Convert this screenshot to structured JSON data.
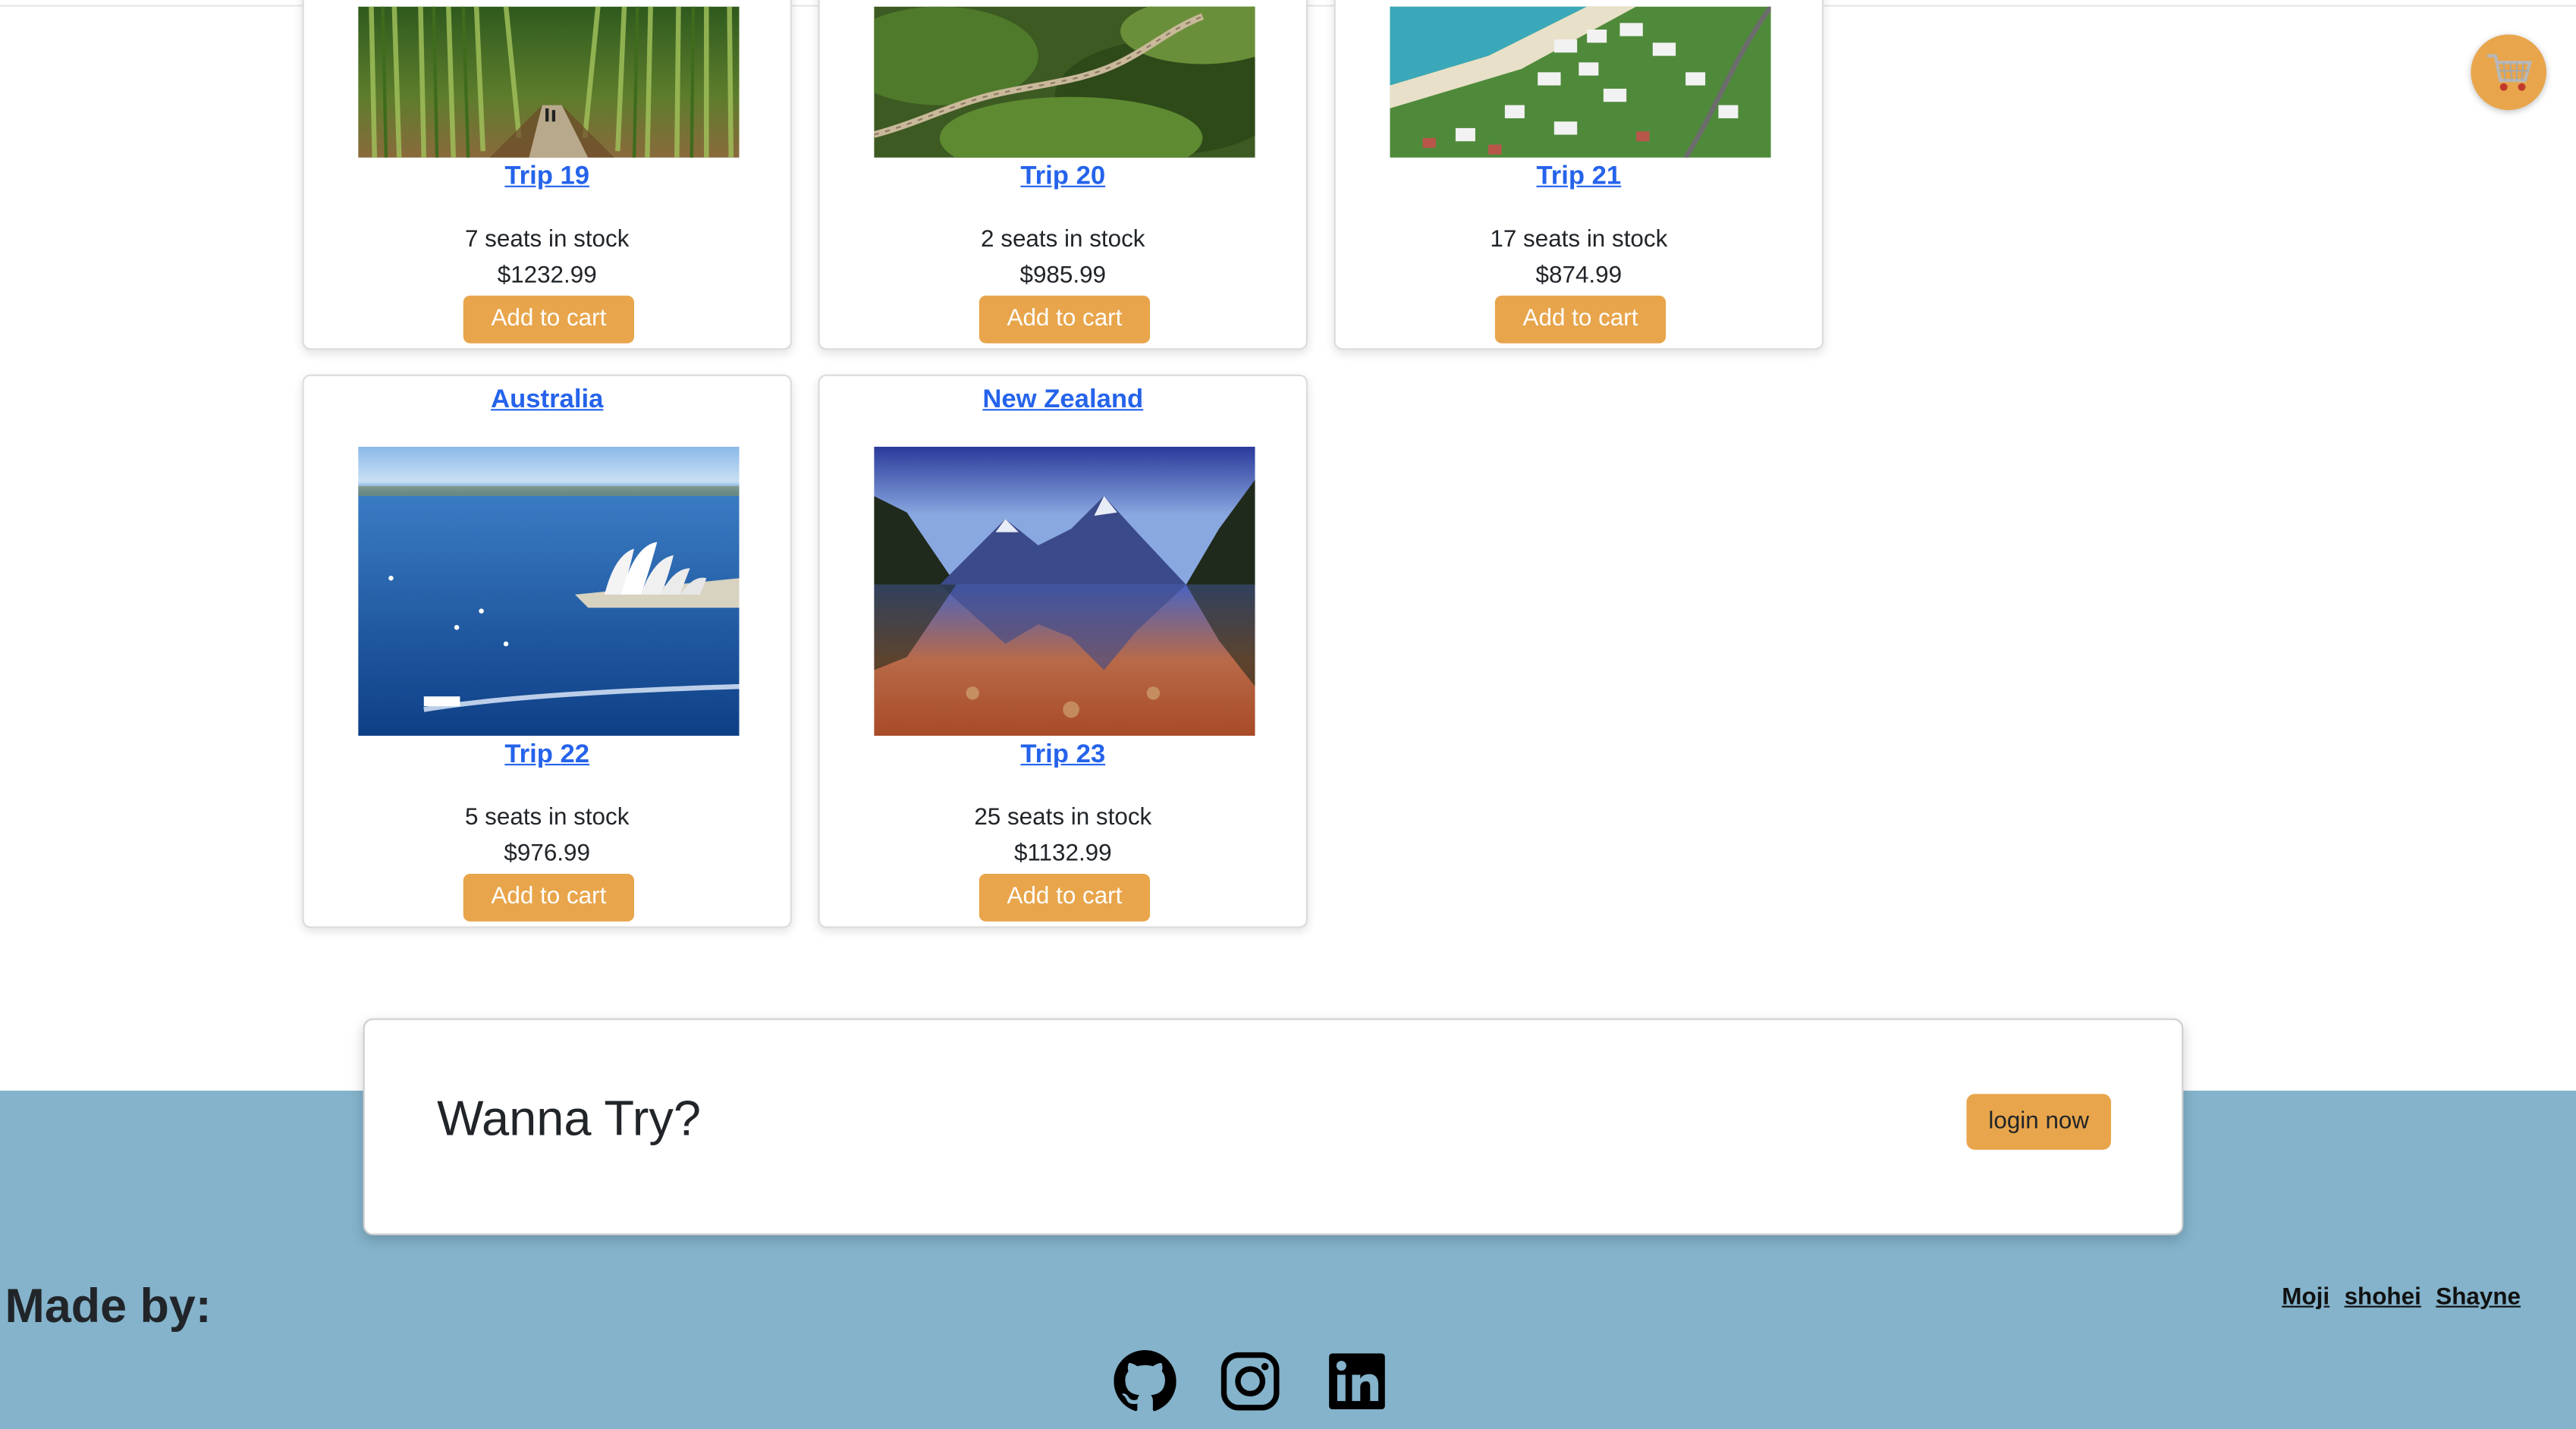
{
  "cart": {
    "icon": "shopping-cart-icon",
    "color": "#e8a54b"
  },
  "trips": [
    {
      "destination": "",
      "trip": "Trip 19",
      "stock": "7 seats in stock",
      "price": "$1232.99",
      "button": "Add to cart",
      "image": "bamboo-forest-path"
    },
    {
      "destination": "",
      "trip": "Trip 20",
      "stock": "2 seats in stock",
      "price": "$985.99",
      "button": "Add to cart",
      "image": "great-wall-mountains"
    },
    {
      "destination": "",
      "trip": "Trip 21",
      "stock": "17 seats in stock",
      "price": "$874.99",
      "button": "Add to cart",
      "image": "coastal-resort"
    },
    {
      "destination": "Australia",
      "trip": "Trip 22",
      "stock": "5 seats in stock",
      "price": "$976.99",
      "button": "Add to cart",
      "image": "sydney-opera-house-harbour"
    },
    {
      "destination": "New Zealand",
      "trip": "Trip 23",
      "stock": "25 seats in stock",
      "price": "$1132.99",
      "button": "Add to cart",
      "image": "milford-sound-mountains"
    }
  ],
  "cta": {
    "title": "Wanna Try?",
    "button": "login now"
  },
  "footer": {
    "made_by": "Made by:",
    "authors": [
      "Moji",
      "shohei",
      "Shayne"
    ],
    "social": [
      "github-icon",
      "instagram-icon",
      "linkedin-icon"
    ],
    "background": "#84b3cb"
  },
  "accent_color": "#e8a54b",
  "link_color": "#2563eb"
}
